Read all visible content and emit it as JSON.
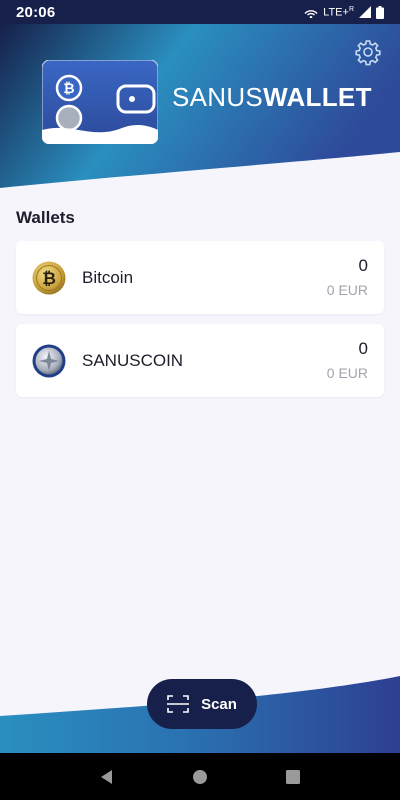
{
  "status_bar": {
    "time": "20:06",
    "network": "LTE+",
    "network_sup": "R",
    "icons": [
      "hotspot-icon",
      "signal-icon",
      "battery-icon"
    ]
  },
  "header": {
    "brand_light": "SANUS",
    "brand_bold": "WALLET",
    "settings_icon": "gear-icon"
  },
  "wallets": {
    "title": "Wallets",
    "items": [
      {
        "name": "Bitcoin",
        "amount": "0",
        "fiat": "0 EUR",
        "icon": "bitcoin-coin-icon"
      },
      {
        "name": "SANUSCOIN",
        "amount": "0",
        "fiat": "0 EUR",
        "icon": "sanuscoin-coin-icon"
      }
    ]
  },
  "scan_button": {
    "label": "Scan",
    "icon": "scan-icon"
  },
  "nav": {
    "back": "back-icon",
    "home": "home-icon",
    "recents": "recents-icon"
  },
  "colors": {
    "header_dark": "#16204a",
    "header_mid": "#2a8fbf",
    "header_right": "#2e4a9a",
    "background": "#f6f5fc",
    "button_bg": "#16204a",
    "muted_text": "#a3a3b0"
  }
}
